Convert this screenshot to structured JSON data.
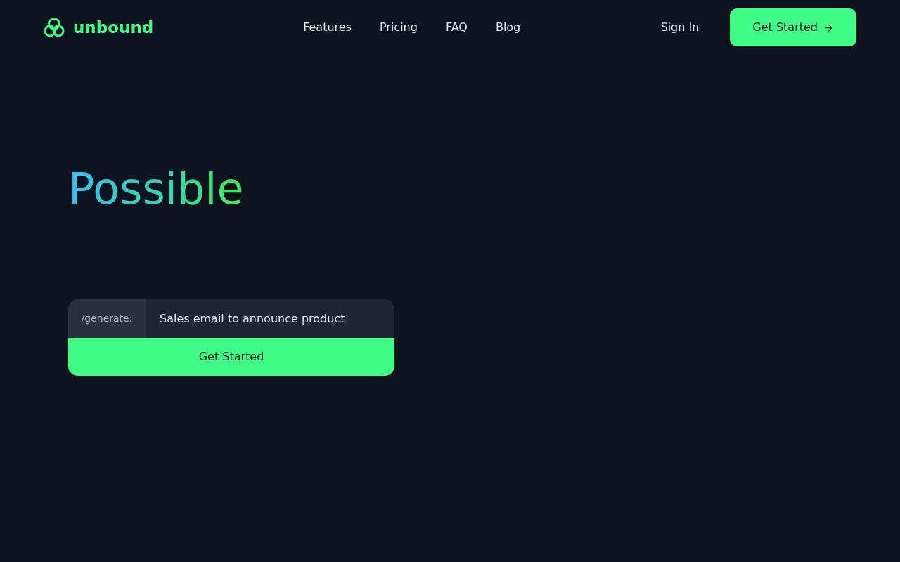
{
  "header": {
    "logo": "unbound",
    "nav": [
      "Features",
      "Pricing",
      "FAQ",
      "Blog"
    ],
    "sign_in": "Sign In",
    "cta": "Get Started"
  },
  "hero": {
    "headline": "Possible",
    "prompt": {
      "prefix": "/generate:",
      "value": "Sales email to announce product"
    },
    "button": "Get Started"
  }
}
